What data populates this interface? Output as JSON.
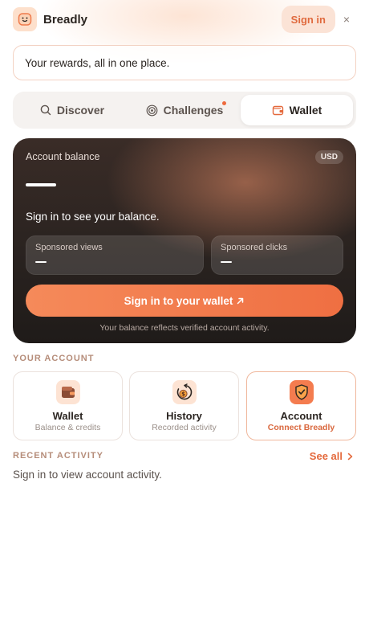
{
  "header": {
    "brand": "Breadly",
    "signin_label": "Sign in",
    "close_glyph": "×"
  },
  "tagline": "Your rewards, all in one place.",
  "tabs": [
    {
      "label": "Discover",
      "icon": "search-icon",
      "active": false
    },
    {
      "label": "Challenges",
      "icon": "target-icon",
      "active": false,
      "notification": true
    },
    {
      "label": "Wallet",
      "icon": "wallet-icon",
      "active": true
    }
  ],
  "balance_card": {
    "label": "Account balance",
    "currency": "USD",
    "message": "Sign in to see your balance.",
    "stats": [
      {
        "label": "Sponsored views"
      },
      {
        "label": "Sponsored clicks"
      }
    ],
    "cta_label": "Sign in to your wallet",
    "note": "Your balance reflects verified account activity."
  },
  "your_account": {
    "heading": "YOUR ACCOUNT",
    "tiles": [
      {
        "title": "Wallet",
        "subtitle": "Balance & credits",
        "icon": "wallet-icon"
      },
      {
        "title": "History",
        "subtitle": "Recorded activity",
        "icon": "history-coin-icon"
      },
      {
        "title": "Account",
        "subtitle": "Connect Breadly",
        "icon": "shield-check-icon"
      }
    ]
  },
  "recent_activity": {
    "heading": "RECENT ACTIVITY",
    "see_all_label": "See all",
    "message": "Sign in to view account activity."
  },
  "colors": {
    "accent": "#ee6a3d",
    "card_dark": "#2a2320",
    "tab_bg": "#f5f2f0"
  }
}
